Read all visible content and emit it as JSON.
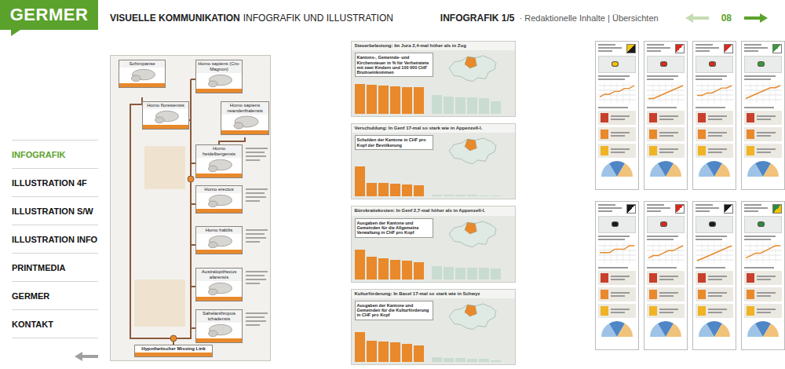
{
  "logo": "GERMER",
  "header": {
    "title_bold": "VISUELLE KOMMUNIKATION",
    "title_rest": "INFOGRAFIK UND ILLUSTRATION",
    "section": "INFOGRAFIK 1/5",
    "subtitle": "· Redaktionelle Inhalte | Übersichten",
    "page": "08",
    "prev_enabled": false,
    "next_enabled": true
  },
  "nav": [
    {
      "label": "INFOGRAFIK",
      "selected": true
    },
    {
      "label": "ILLUSTRATION 4F",
      "selected": false
    },
    {
      "label": "ILLUSTRATION S/W",
      "selected": false
    },
    {
      "label": "ILLUSTRATION INFO",
      "selected": false
    },
    {
      "label": "PRINTMEDIA",
      "selected": false
    },
    {
      "label": "GERMER",
      "selected": false
    },
    {
      "label": "KONTAKT",
      "selected": false
    }
  ],
  "back_enabled": false,
  "evolution": {
    "nodes": [
      {
        "label": "Schimpanse",
        "kind": "species"
      },
      {
        "label": "Homo sapiens (Cro-Magnon)",
        "kind": "species"
      },
      {
        "label": "Homo floresiensis",
        "kind": "species"
      },
      {
        "label": "Homo sapiens neanderthalensis",
        "kind": "species"
      },
      {
        "label": "Homo heidelbergensis",
        "kind": "species"
      },
      {
        "label": "Homo erectus",
        "kind": "species"
      },
      {
        "label": "Homo habilis",
        "kind": "species"
      },
      {
        "label": "Australopithecus afarensis",
        "kind": "species"
      },
      {
        "label": "Sahelanthropus tchadensis",
        "kind": "species"
      },
      {
        "label": "Hypothetischer Missing Link",
        "kind": "root"
      }
    ]
  },
  "tax_charts": [
    {
      "title": "Steuerbelastung: Im Jura 2,4-mal höher als in Zug",
      "caption": "Kantons-, Gemeinde- und Kirchensteuer in % für Verheiratete mit zwei Kindern und 100 000 CHF Bruttoeinkommen",
      "highlight": [
        12.6,
        12.3,
        12.1,
        11.7,
        11.5,
        11.2
      ],
      "others": [
        8.1,
        7.3,
        7.1,
        6.9,
        6.6,
        5.3
      ]
    },
    {
      "title": "Verschuldung: In Genf 17-mal so stark wie in Appenzell-I.",
      "caption": "Schulden der Kantone in CHF pro Kopf der Bevölkerung",
      "highlight": [
        19000,
        8800,
        8500,
        8200,
        7600,
        7200
      ],
      "others": [
        1400,
        1200,
        1100,
        1000,
        900,
        800
      ]
    },
    {
      "title": "Bürokratiekosten: In Genf 2,7-mal höher als in Appenzell-I.",
      "caption": "Ausgaben der Kantone und Gemeinden für die Allgemeine Verwaltung in CHF pro Kopf",
      "highlight": [
        2300,
        1700,
        1600,
        1500,
        1400,
        1300
      ],
      "others": [
        1000,
        950,
        900,
        880,
        860,
        850
      ]
    },
    {
      "title": "Kulturförderung: In Basel 17-mal so stark wie in Schwyz",
      "caption": "Ausgaben der Kantone und Gemeinden für die Kulturförderung in CHF pro Kopf",
      "highlight": [
        420,
        300,
        290,
        270,
        250,
        230
      ],
      "others": [
        60,
        55,
        50,
        45,
        40,
        25
      ]
    }
  ],
  "cantons": [
    {
      "color": "#f4c300",
      "color2": "#1a1a1a",
      "trend": [
        2,
        3,
        3,
        4,
        4,
        5,
        5,
        6
      ]
    },
    {
      "color": "#d52b1e",
      "color2": "#ffffff",
      "trend": [
        2,
        2,
        3,
        4,
        5,
        6,
        7,
        8
      ]
    },
    {
      "color": "#d52b1e",
      "color2": "#ffffff",
      "trend": [
        3,
        3,
        4,
        4,
        5,
        6,
        6,
        7
      ]
    },
    {
      "color": "#3a9a3a",
      "color2": "#ffffff",
      "trend": [
        2,
        3,
        4,
        5,
        6,
        7,
        7,
        8
      ]
    },
    {
      "color": "#1a1a1a",
      "color2": "#ffffff",
      "trend": [
        3,
        3,
        3,
        4,
        4,
        4,
        5,
        5
      ]
    },
    {
      "color": "#d52b1e",
      "color2": "#ffffff",
      "trend": [
        2,
        3,
        3,
        4,
        5,
        5,
        6,
        7
      ]
    },
    {
      "color": "#1a1a1a",
      "color2": "#ffffff",
      "trend": [
        1,
        2,
        3,
        4,
        5,
        6,
        7,
        8
      ]
    },
    {
      "color": "#2e8b3a",
      "color2": "#f4c300",
      "trend": [
        2,
        3,
        4,
        4,
        5,
        6,
        7,
        7
      ]
    }
  ]
}
